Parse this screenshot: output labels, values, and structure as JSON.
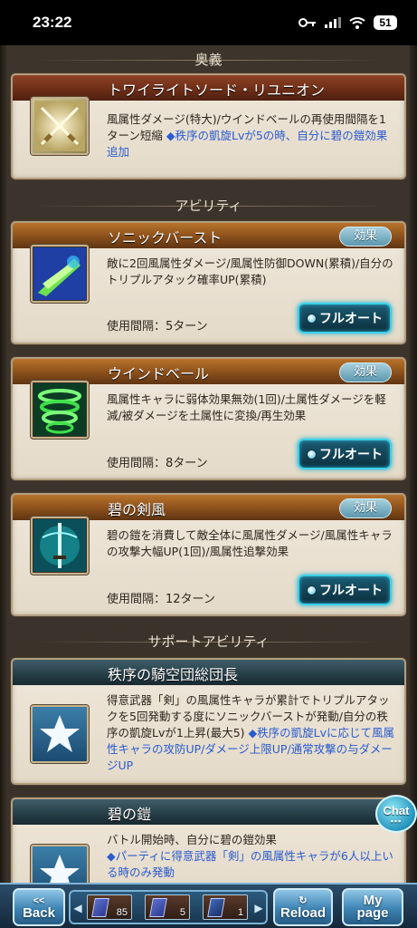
{
  "status_bar": {
    "time": "23:22",
    "battery": "51",
    "icons": [
      "key-icon",
      "signal-icon",
      "wifi-icon",
      "battery-icon"
    ]
  },
  "ougi": {
    "header": "奥義",
    "title": "トワイライトソード・リユニオン",
    "desc_main": "風属性ダメージ(特大)/ウインドベールの再使用間隔を1ターン短縮",
    "desc_note": "◆秩序の凱旋Lvが5の時、自分に碧の鎧効果追加"
  },
  "abilities": {
    "header": "アビリティ",
    "effect_label": "効果",
    "fullauto_label": "フルオート",
    "items": [
      {
        "title": "ソニックバースト",
        "desc": "敵に2回風属性ダメージ/風属性防御DOWN(累積)/自分のトリプルアタック確率UP(累積)",
        "cooldown": "使用間隔：5ターン"
      },
      {
        "title": "ウインドベール",
        "desc": "風属性キャラに弱体効果無効(1回)/土属性ダメージを軽減/被ダメージを土属性に変換/再生効果",
        "cooldown": "使用間隔：8ターン"
      },
      {
        "title": "碧の剣風",
        "desc": "碧の鎧を消費して敵全体に風属性ダメージ/風属性キャラの攻撃大幅UP(1回)/風属性追撃効果",
        "cooldown": "使用間隔：12ターン"
      }
    ]
  },
  "support": {
    "header": "サポートアビリティ",
    "items": [
      {
        "title": "秩序の騎空団総団長",
        "desc_main": "得意武器「剣」の風属性キャラが累計でトリプルアタックを5回発動する度にソニックバーストが発動/自分の秩序の凱旋Lvが1上昇(最大5)",
        "desc_note": "◆秩序の凱旋Lvに応じて風属性キャラの攻防UP/ダメージ上限UP/通常攻撃の与ダメージUP"
      },
      {
        "title": "碧の鎧",
        "desc_main": "バトル開始時、自分に碧の鎧効果",
        "desc_note": "◆パーティに得意武器「剣」の風属性キャラが6人以上いる時のみ発動"
      }
    ]
  },
  "chat": {
    "label": "Chat",
    "dots": "•••"
  },
  "bottom_nav": {
    "back_small": "<<",
    "back_label": "Back",
    "reload_small": "↻",
    "reload_label": "Reload",
    "mypage_top": "My",
    "mypage_bottom": "page",
    "slot_counts": [
      "85",
      "5",
      "1"
    ],
    "left_arrow": "◀",
    "right_arrow": "▶"
  }
}
